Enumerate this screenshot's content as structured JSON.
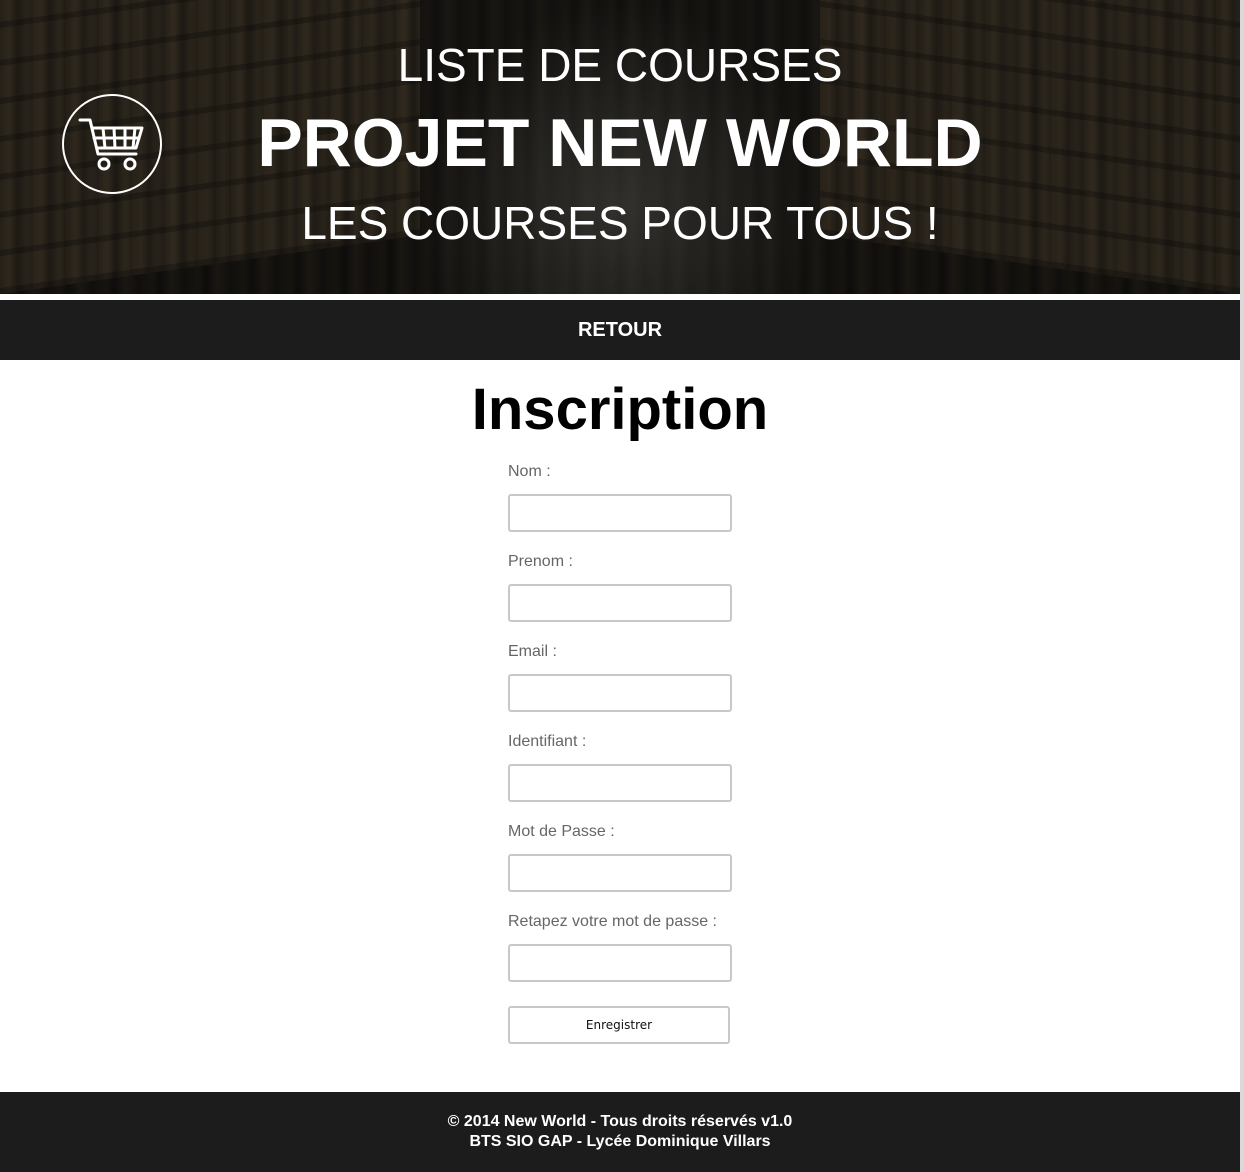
{
  "header": {
    "line1": "LISTE DE COURSES",
    "line2": "PROJET NEW WORLD",
    "line3": "LES COURSES POUR TOUS !",
    "logo_icon": "shopping-cart-icon"
  },
  "nav": {
    "back_label": "RETOUR"
  },
  "main": {
    "title": "Inscription",
    "fields": [
      {
        "label": "Nom :",
        "value": ""
      },
      {
        "label": "Prenom :",
        "value": ""
      },
      {
        "label": "Email :",
        "value": ""
      },
      {
        "label": "Identifiant :",
        "value": ""
      },
      {
        "label": "Mot de Passe :",
        "value": ""
      },
      {
        "label": "Retapez votre mot de passe :",
        "value": ""
      }
    ],
    "submit_label": "Enregistrer"
  },
  "footer": {
    "line1": "© 2014 New World - Tous droits réservés v1.0",
    "line2": "BTS SIO GAP - Lycée Dominique Villars"
  },
  "colors": {
    "bar_background": "#1c1c1c",
    "label_text": "#666666",
    "input_border": "#c8c8c8"
  }
}
